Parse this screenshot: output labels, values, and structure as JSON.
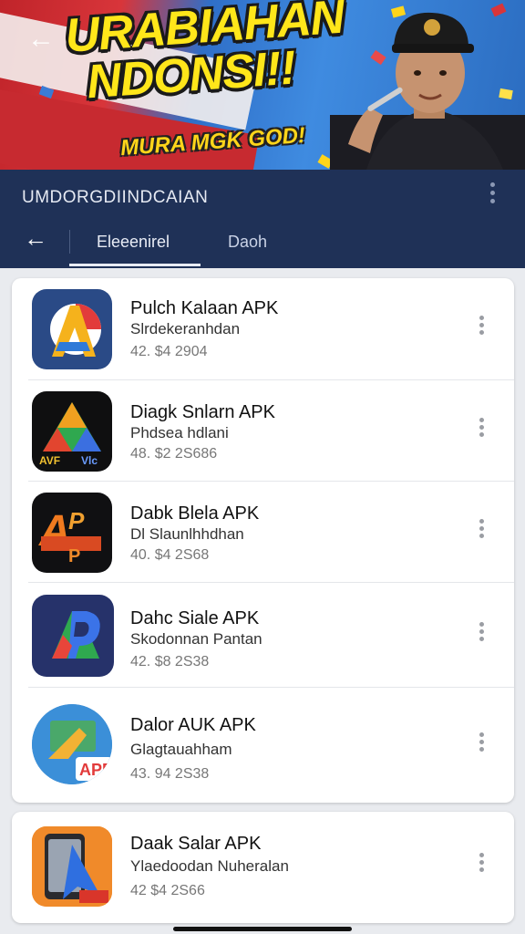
{
  "banner": {
    "headline_line1": "URABIAHAN",
    "headline_line2": "NDONSI!!",
    "subhead": "MURA MGK GOD!"
  },
  "header": {
    "app_title": "UMDORGDIINDCAIAN"
  },
  "tabs": [
    {
      "label": "Eleeenirel",
      "active": true
    },
    {
      "label": "Daoh",
      "active": false
    }
  ],
  "apps": [
    {
      "name": "Pulch Kalaan APK",
      "subtitle": "Slrdekeranhdan",
      "meta": "42. $4 2904",
      "icon": "a-letter-blue-icon"
    },
    {
      "name": "Diagk Snlarn APK",
      "subtitle": "Phdsea hdlani",
      "meta": "48. $2 2S686",
      "icon": "tricolor-triangle-icon"
    },
    {
      "name": "Dabk Blela APK",
      "subtitle": "Dl Slaunlhhdhan",
      "meta": "40. $4 2S68",
      "icon": "ap-letters-icon"
    },
    {
      "name": "Dahc Siale APK",
      "subtitle": "Skodonnan Pantan",
      "meta": "42. $8 2S38",
      "icon": "p-letter-blue-icon"
    },
    {
      "name": "Dalor AUK APK",
      "subtitle": "Glagtauahham",
      "meta": "43. 94 2S38",
      "icon": "apb-globe-icon"
    },
    {
      "name": "Daak Salar APK",
      "subtitle": "Ylaedoodan Nuheralan",
      "meta": "42 $4 2S66",
      "icon": "phone-arrow-icon"
    }
  ],
  "colors": {
    "topbar": "#1f3157",
    "card_bg": "#ffffff",
    "page_bg": "#e9ebef",
    "headline_yellow": "#ffe61a"
  }
}
